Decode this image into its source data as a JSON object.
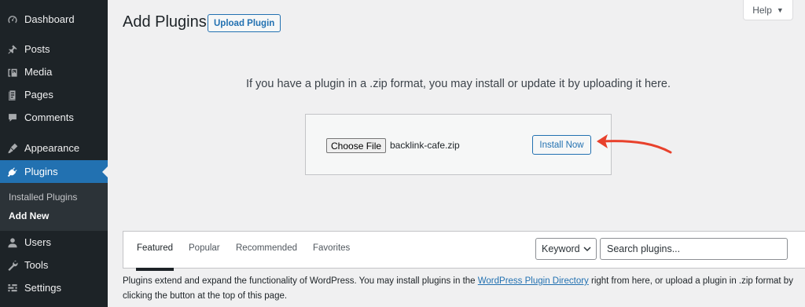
{
  "sidebar": {
    "items": [
      {
        "label": "Dashboard",
        "icon": "dashboard-icon"
      },
      {
        "label": "Posts",
        "icon": "pin-icon"
      },
      {
        "label": "Media",
        "icon": "media-icon"
      },
      {
        "label": "Pages",
        "icon": "page-icon"
      },
      {
        "label": "Comments",
        "icon": "comment-icon"
      },
      {
        "label": "Appearance",
        "icon": "brush-icon"
      },
      {
        "label": "Plugins",
        "icon": "plugin-icon",
        "active": true
      },
      {
        "label": "Users",
        "icon": "user-icon"
      },
      {
        "label": "Tools",
        "icon": "wrench-icon"
      },
      {
        "label": "Settings",
        "icon": "settings-icon"
      }
    ],
    "submenu": [
      {
        "label": "Installed Plugins"
      },
      {
        "label": "Add New",
        "current": true
      }
    ]
  },
  "header": {
    "title": "Add Plugins",
    "upload_label": "Upload Plugin",
    "help_label": "Help"
  },
  "upload": {
    "instructions": "If you have a plugin in a .zip format, you may install or update it by uploading it here.",
    "choose_label": "Choose File",
    "file_name": "backlink-cafe.zip",
    "install_label": "Install Now"
  },
  "filter": {
    "tabs": [
      "Featured",
      "Popular",
      "Recommended",
      "Favorites"
    ],
    "current_tab": "Featured",
    "search_type": "Keyword",
    "search_placeholder": "Search plugins..."
  },
  "description": {
    "before_link": "Plugins extend and expand the functionality of WordPress. You may install plugins in the ",
    "link_text": "WordPress Plugin Directory",
    "after_link": " right from here, or upload a plugin in .zip format by clicking the button at the top of this page."
  },
  "colors": {
    "sidebar_bg": "#1d2327",
    "accent": "#2271b1",
    "annotation_arrow": "#e8412c"
  }
}
